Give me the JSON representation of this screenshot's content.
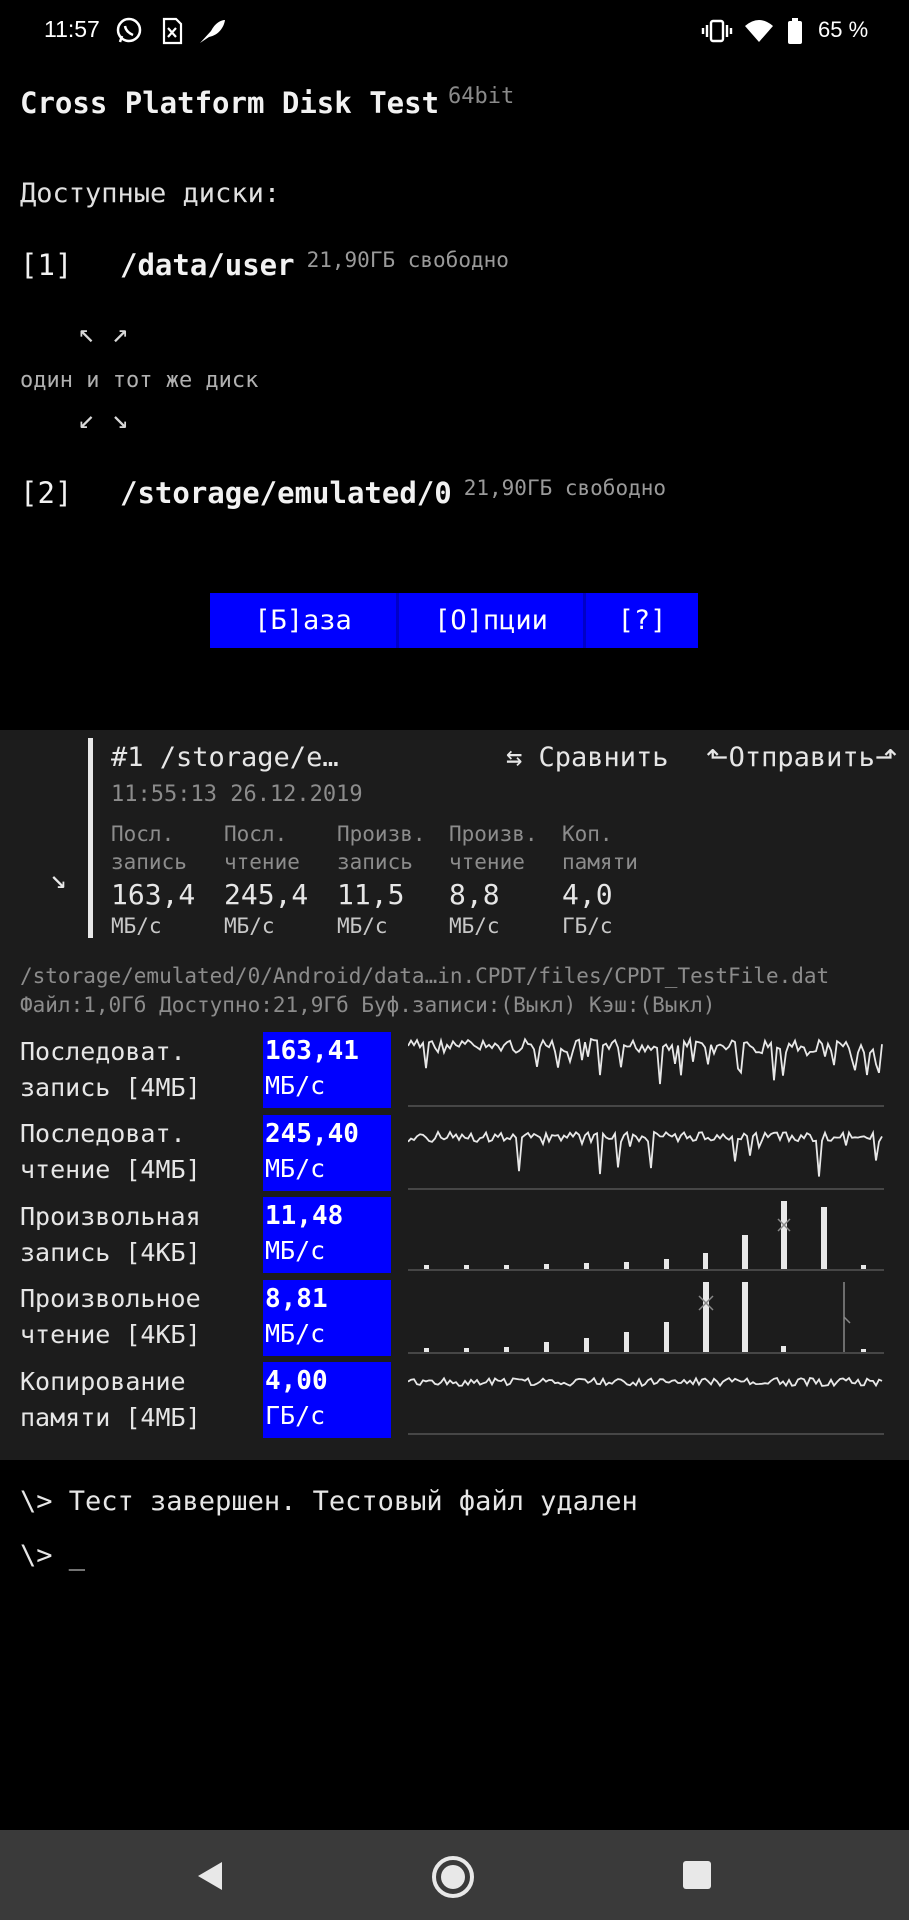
{
  "status_bar": {
    "time": "11:57",
    "battery_percent": "65 %",
    "left_icons": [
      "whatsapp-icon",
      "sim-icon",
      "feather-app-icon"
    ],
    "right_icons": [
      "vibrate-icon",
      "wifi-icon",
      "battery-icon"
    ]
  },
  "app": {
    "title": "Cross Platform Disk Test",
    "arch": "64bit"
  },
  "disks": {
    "header": "Доступные диски:",
    "items": [
      {
        "index": "[1]",
        "path": "/data/user",
        "free": "21,90ГБ свободно"
      },
      {
        "index": "[2]",
        "path": "/storage/emulated/0",
        "free": "21,90ГБ свободно"
      }
    ],
    "same_disk_note": "один и тот же диск",
    "arrows_top": "↖ ↗",
    "arrows_bottom": "↙ ↘"
  },
  "menu": {
    "base": "[Б]аза",
    "options": "[О]пции",
    "help": "[?]"
  },
  "result": {
    "collapse_arrow": "↘",
    "title": "#1 /storage/e…",
    "datetime": "11:55:13 26.12.2019",
    "compare_label": "⇆ Сравнить",
    "send_label": "⬑Отправить⬏",
    "stats": [
      {
        "label": "Посл.\nзапись",
        "value": "163,4",
        "unit": "МБ/с"
      },
      {
        "label": "Посл.\nчтение",
        "value": "245,4",
        "unit": "МБ/с"
      },
      {
        "label": "Произв.\nзапись",
        "value": "11,5",
        "unit": "МБ/с"
      },
      {
        "label": "Произв.\nчтение",
        "value": "8,8",
        "unit": "МБ/с"
      },
      {
        "label": "Коп.\nпамяти",
        "value": "4,0",
        "unit": "ГБ/с"
      }
    ]
  },
  "details": {
    "file_path": "/storage/emulated/0/Android/data…in.CPDT/files/CPDT_TestFile.dat",
    "file_info": "Файл:1,0Гб Доступно:21,9Гб Буф.записи:(Выкл) Кэш:(Выкл)"
  },
  "tests": [
    {
      "line1": "Последоват.",
      "line2": "запись [4МБ]",
      "value": "163,41",
      "unit": "МБ/с"
    },
    {
      "line1": "Последоват.",
      "line2": "чтение [4МБ]",
      "value": "245,40",
      "unit": "МБ/с"
    },
    {
      "line1": "Произвольная",
      "line2": "запись [4КБ]",
      "value": "11,48",
      "unit": "МБ/с"
    },
    {
      "line1": "Произвольное",
      "line2": "чтение [4КБ]",
      "value": "8,81",
      "unit": "МБ/с"
    },
    {
      "line1": "Копирование",
      "line2": "памяти [4МБ]",
      "value": "4,00",
      "unit": "ГБ/с"
    }
  ],
  "console": {
    "line1": "\\> Тест завершен. Тестовый файл удален",
    "line2": "\\> _"
  },
  "nav": {
    "icons": [
      "back-icon",
      "home-icon",
      "recents-icon"
    ]
  },
  "colors": {
    "accent_blue": "#0000ff",
    "background": "#000000",
    "panel": "#1c1c1c"
  }
}
